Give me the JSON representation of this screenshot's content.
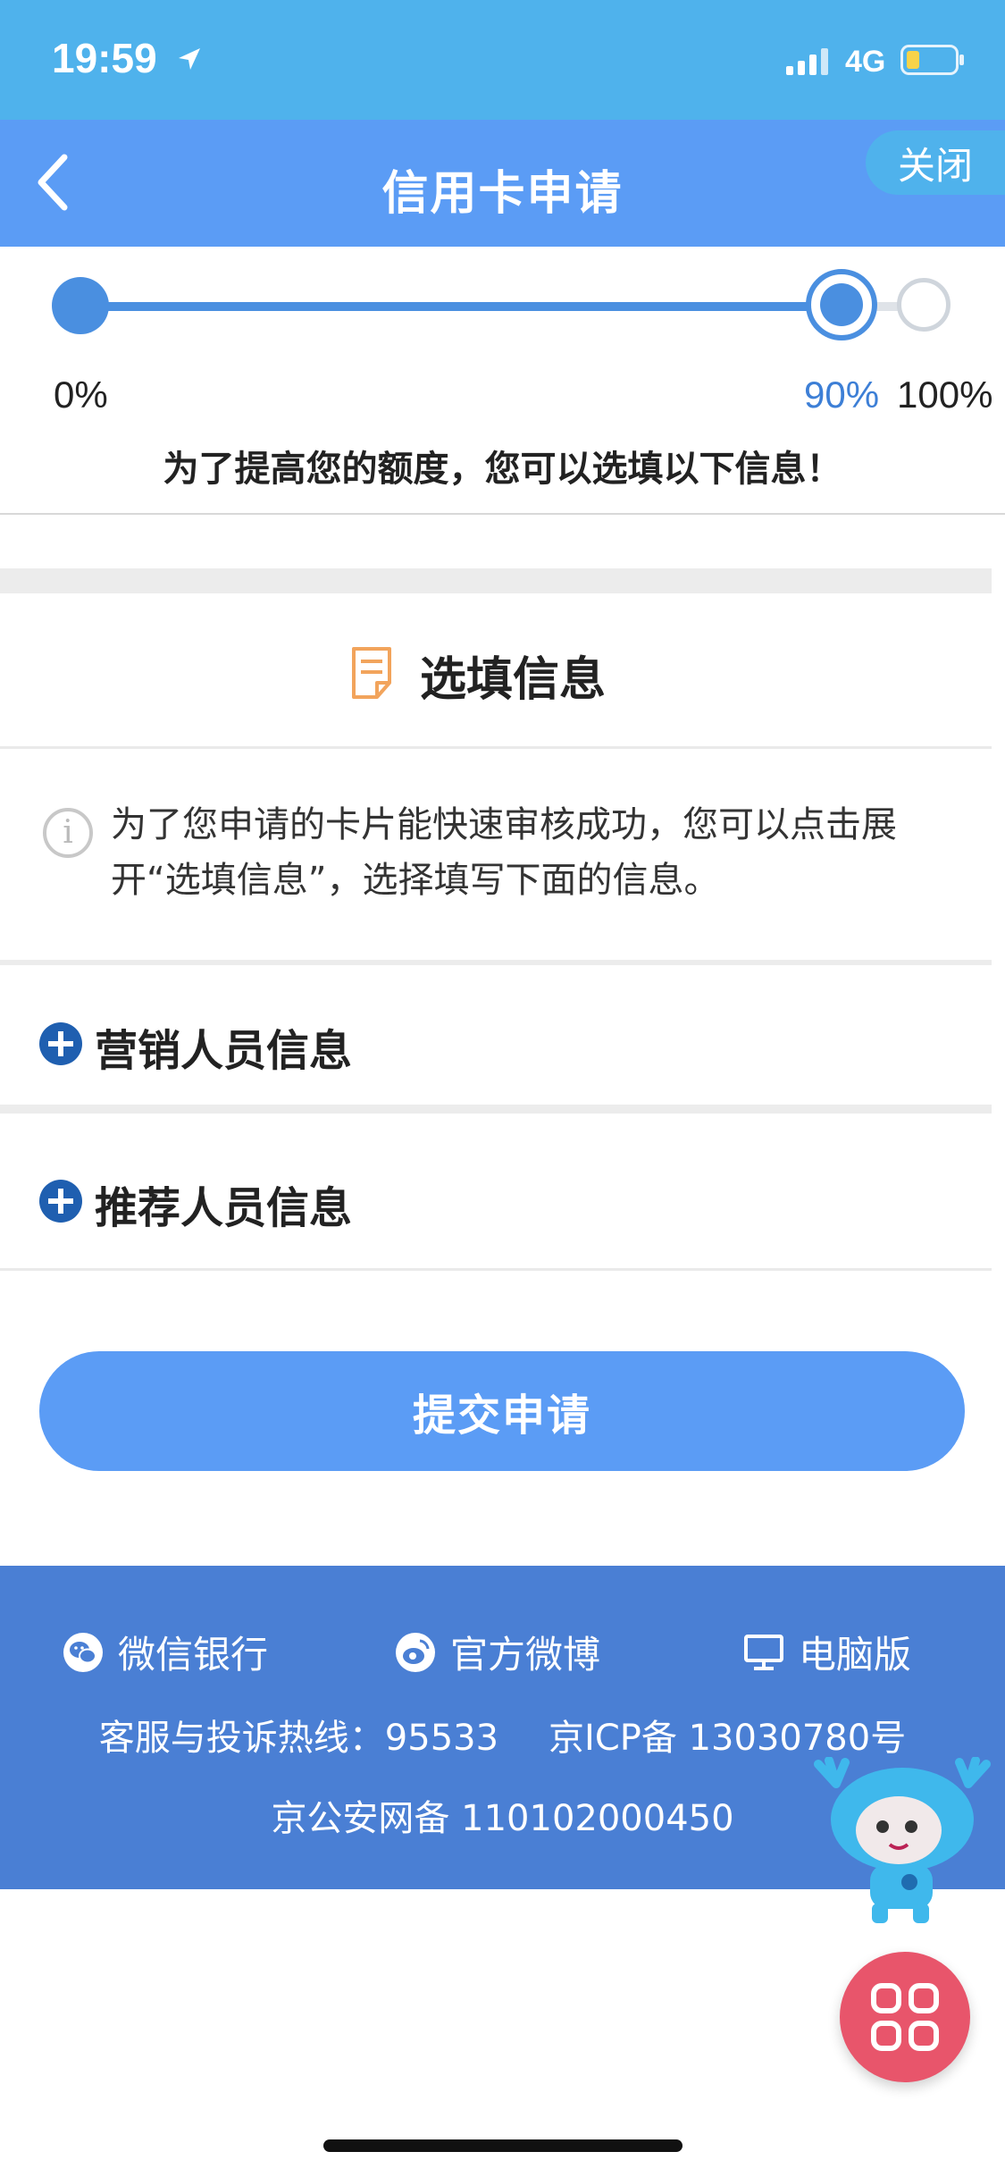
{
  "status_bar": {
    "time": "19:59",
    "network": "4G"
  },
  "nav": {
    "title": "信用卡申请",
    "close_label": "关闭"
  },
  "progress": {
    "start_label": "0%",
    "current_label": "90%",
    "end_label": "100%",
    "current_fraction": 0.9,
    "hint": "为了提高您的额度，您可以选填以下信息！"
  },
  "section": {
    "title": "选填信息",
    "info_text": "为了您申请的卡片能快速审核成功，您可以点击展开“选填信息”，选择填写下面的信息。"
  },
  "expand_rows": [
    {
      "label": "营销人员信息"
    },
    {
      "label": "推荐人员信息"
    }
  ],
  "submit_label": "提交申请",
  "footer": {
    "links": [
      "微信银行",
      "官方微博",
      "电脑版"
    ],
    "hotline": "客服与投诉热线：95533",
    "icp": "京ICP备 13030780号",
    "police": "京公安网备 110102000450"
  },
  "colors": {
    "status_bar": "#4fb2ec",
    "nav_bar": "#5b9cf5",
    "accent": "#4a8fe0",
    "footer": "#4a7fd4",
    "float_button": "#e8556b"
  }
}
